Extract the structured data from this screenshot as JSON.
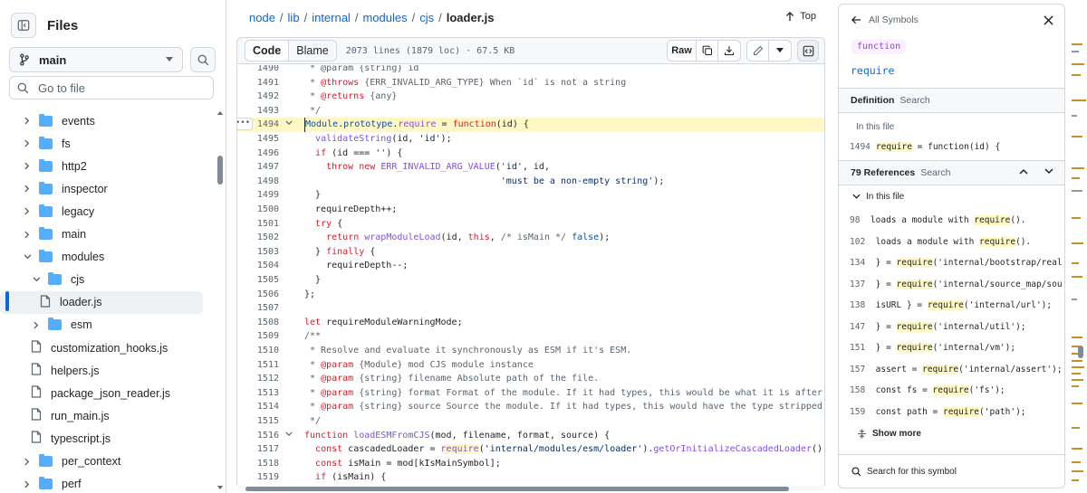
{
  "left": {
    "title": "Files",
    "branch": "main",
    "go_to_file_placeholder": "Go to file",
    "tree": [
      {
        "label": "events",
        "type": "folder",
        "depth": 1,
        "expanded": false
      },
      {
        "label": "fs",
        "type": "folder",
        "depth": 1,
        "expanded": false
      },
      {
        "label": "http2",
        "type": "folder",
        "depth": 1,
        "expanded": false
      },
      {
        "label": "inspector",
        "type": "folder",
        "depth": 1,
        "expanded": false
      },
      {
        "label": "legacy",
        "type": "folder",
        "depth": 1,
        "expanded": false
      },
      {
        "label": "main",
        "type": "folder",
        "depth": 1,
        "expanded": false
      },
      {
        "label": "modules",
        "type": "folder",
        "depth": 1,
        "expanded": true
      },
      {
        "label": "cjs",
        "type": "folder",
        "depth": 2,
        "expanded": true
      },
      {
        "label": "loader.js",
        "type": "file",
        "depth": 3,
        "selected": true
      },
      {
        "label": "esm",
        "type": "folder",
        "depth": 2,
        "expanded": false
      },
      {
        "label": "customization_hooks.js",
        "type": "file",
        "depth": 2
      },
      {
        "label": "helpers.js",
        "type": "file",
        "depth": 2
      },
      {
        "label": "package_json_reader.js",
        "type": "file",
        "depth": 2
      },
      {
        "label": "run_main.js",
        "type": "file",
        "depth": 2
      },
      {
        "label": "typescript.js",
        "type": "file",
        "depth": 2
      },
      {
        "label": "per_context",
        "type": "folder",
        "depth": 1,
        "expanded": false
      },
      {
        "label": "perf",
        "type": "folder",
        "depth": 1,
        "expanded": false
      }
    ]
  },
  "breadcrumb": [
    "node",
    "lib",
    "internal",
    "modules",
    "cjs"
  ],
  "breadcrumb_file": "loader.js",
  "top_label": "Top",
  "toolbar": {
    "code": "Code",
    "blame": "Blame",
    "meta": "2073 lines (1879 loc) · 67.5 KB",
    "raw": "Raw"
  },
  "code_lines": [
    {
      "n": "1490",
      "h": "<span class=\"cm\"> * @param {string} id</span>"
    },
    {
      "n": "1491",
      "h": "<span class=\"cm\"> * <span class=\"kw\">@throws</span> {ERR_INVALID_ARG_TYPE} When `id` is not a string</span>"
    },
    {
      "n": "1492",
      "h": "<span class=\"cm\"> * <span class=\"kw\">@returns</span> {any}</span>"
    },
    {
      "n": "1493",
      "h": "<span class=\"cm\"> */</span>"
    },
    {
      "n": "1494",
      "h": "<span class=\"tg\">Module</span>.<span class=\"tg\">prototype</span>.<span class=\"fn rq\">require</span> = <span class=\"kw\">function</span>(id) {",
      "hl": true,
      "fold": true
    },
    {
      "n": "1495",
      "h": "  <span class=\"fn\">validateString</span>(id, <span class=\"st\">'id'</span>);"
    },
    {
      "n": "1496",
      "h": "  <span class=\"kw\">if</span> (id === <span class=\"st\">''</span>) {"
    },
    {
      "n": "1497",
      "h": "    <span class=\"kw\">throw new</span> <span class=\"fn\">ERR_INVALID_ARG_VALUE</span>(<span class=\"st\">'id'</span>, id,"
    },
    {
      "n": "1498",
      "h": "                                    <span class=\"st\">'must be a non-empty string'</span>);"
    },
    {
      "n": "1499",
      "h": "  }"
    },
    {
      "n": "1500",
      "h": "  requireDepth++;"
    },
    {
      "n": "1501",
      "h": "  <span class=\"kw\">try</span> {"
    },
    {
      "n": "1502",
      "h": "    <span class=\"kw\">return</span> <span class=\"fn\">wrapModuleLoad</span>(id, <span class=\"kw\">this</span>, <span class=\"cm\">/* isMain */</span> <span class=\"tg\">false</span>);"
    },
    {
      "n": "1503",
      "h": "  } <span class=\"kw\">finally</span> {"
    },
    {
      "n": "1504",
      "h": "    requireDepth--;"
    },
    {
      "n": "1505",
      "h": "  }"
    },
    {
      "n": "1506",
      "h": "};"
    },
    {
      "n": "1507",
      "h": ""
    },
    {
      "n": "1508",
      "h": "<span class=\"kw\">let</span> requireModuleWarningMode;"
    },
    {
      "n": "1509",
      "h": "<span class=\"cm\">/**</span>"
    },
    {
      "n": "1510",
      "h": "<span class=\"cm\"> * Resolve and evaluate it synchronously as ESM if it's ESM.</span>"
    },
    {
      "n": "1511",
      "h": "<span class=\"cm\"> * <span class=\"kw\">@param</span> {Module} mod CJS module instance</span>"
    },
    {
      "n": "1512",
      "h": "<span class=\"cm\"> * <span class=\"kw\">@param</span> {string} filename Absolute path of the file.</span>"
    },
    {
      "n": "1513",
      "h": "<span class=\"cm\"> * <span class=\"kw\">@param</span> {string} format Format of the module. If it had types, this would be what it is after type-stripping.</span>"
    },
    {
      "n": "1514",
      "h": "<span class=\"cm\"> * <span class=\"kw\">@param</span> {string} source Source the module. If it had types, this would have the type stripped.</span>"
    },
    {
      "n": "1515",
      "h": "<span class=\"cm\"> */</span>"
    },
    {
      "n": "1516",
      "h": "<span class=\"kw\">function</span> <span class=\"fn\">loadESMFromCJS</span>(mod, filename, format, source) {",
      "fold": true
    },
    {
      "n": "1517",
      "h": "  <span class=\"kw\">const</span> cascadedLoader = <span class=\"fn rq\">require</span>(<span class=\"st\">'internal/modules/esm/loader'</span>).<span class=\"fn\">getOrInitializeCascadedLoader</span>();"
    },
    {
      "n": "1518",
      "h": "  <span class=\"kw\">const</span> isMain = mod[kIsMainSymbol];"
    },
    {
      "n": "1519",
      "h": "  <span class=\"kw\">if</span> (isMain) {"
    }
  ],
  "symbols": {
    "back_label": "All Symbols",
    "kind": "function",
    "name": "require",
    "definition_label": "Definition",
    "search_label": "Search",
    "in_this_file": "In this file",
    "definition_line": {
      "n": "1494",
      "h": "<span class=\"rq\">require</span> = function(id) {"
    },
    "references_label": "79 References",
    "refs": [
      {
        "n": "98",
        "h": "loads a module with <span class=\"rq\">require</span>()."
      },
      {
        "n": "102",
        "h": "loads a module with <span class=\"rq\">require</span>()."
      },
      {
        "n": "134",
        "h": "} = <span class=\"rq\">require</span>('internal/bootstrap/realm');"
      },
      {
        "n": "137",
        "h": "} = <span class=\"rq\">require</span>('internal/source_map/source_m"
      },
      {
        "n": "138",
        "h": "isURL } = <span class=\"rq\">require</span>('internal/url');"
      },
      {
        "n": "147",
        "h": "} = <span class=\"rq\">require</span>('internal/util');"
      },
      {
        "n": "151",
        "h": "} = <span class=\"rq\">require</span>('internal/vm');"
      },
      {
        "n": "157",
        "h": "assert = <span class=\"rq\">require</span>('internal/assert');"
      },
      {
        "n": "158",
        "h": "const fs = <span class=\"rq\">require</span>('fs');"
      },
      {
        "n": "159",
        "h": "const path = <span class=\"rq\">require</span>('path');"
      }
    ],
    "show_more": "Show more",
    "search_symbol": "Search for this symbol"
  },
  "colors": {
    "accent": "#0969da",
    "highlight": "#fff8c5",
    "keyword": "#cf222e",
    "function": "#8250df",
    "string": "#0a3069"
  }
}
